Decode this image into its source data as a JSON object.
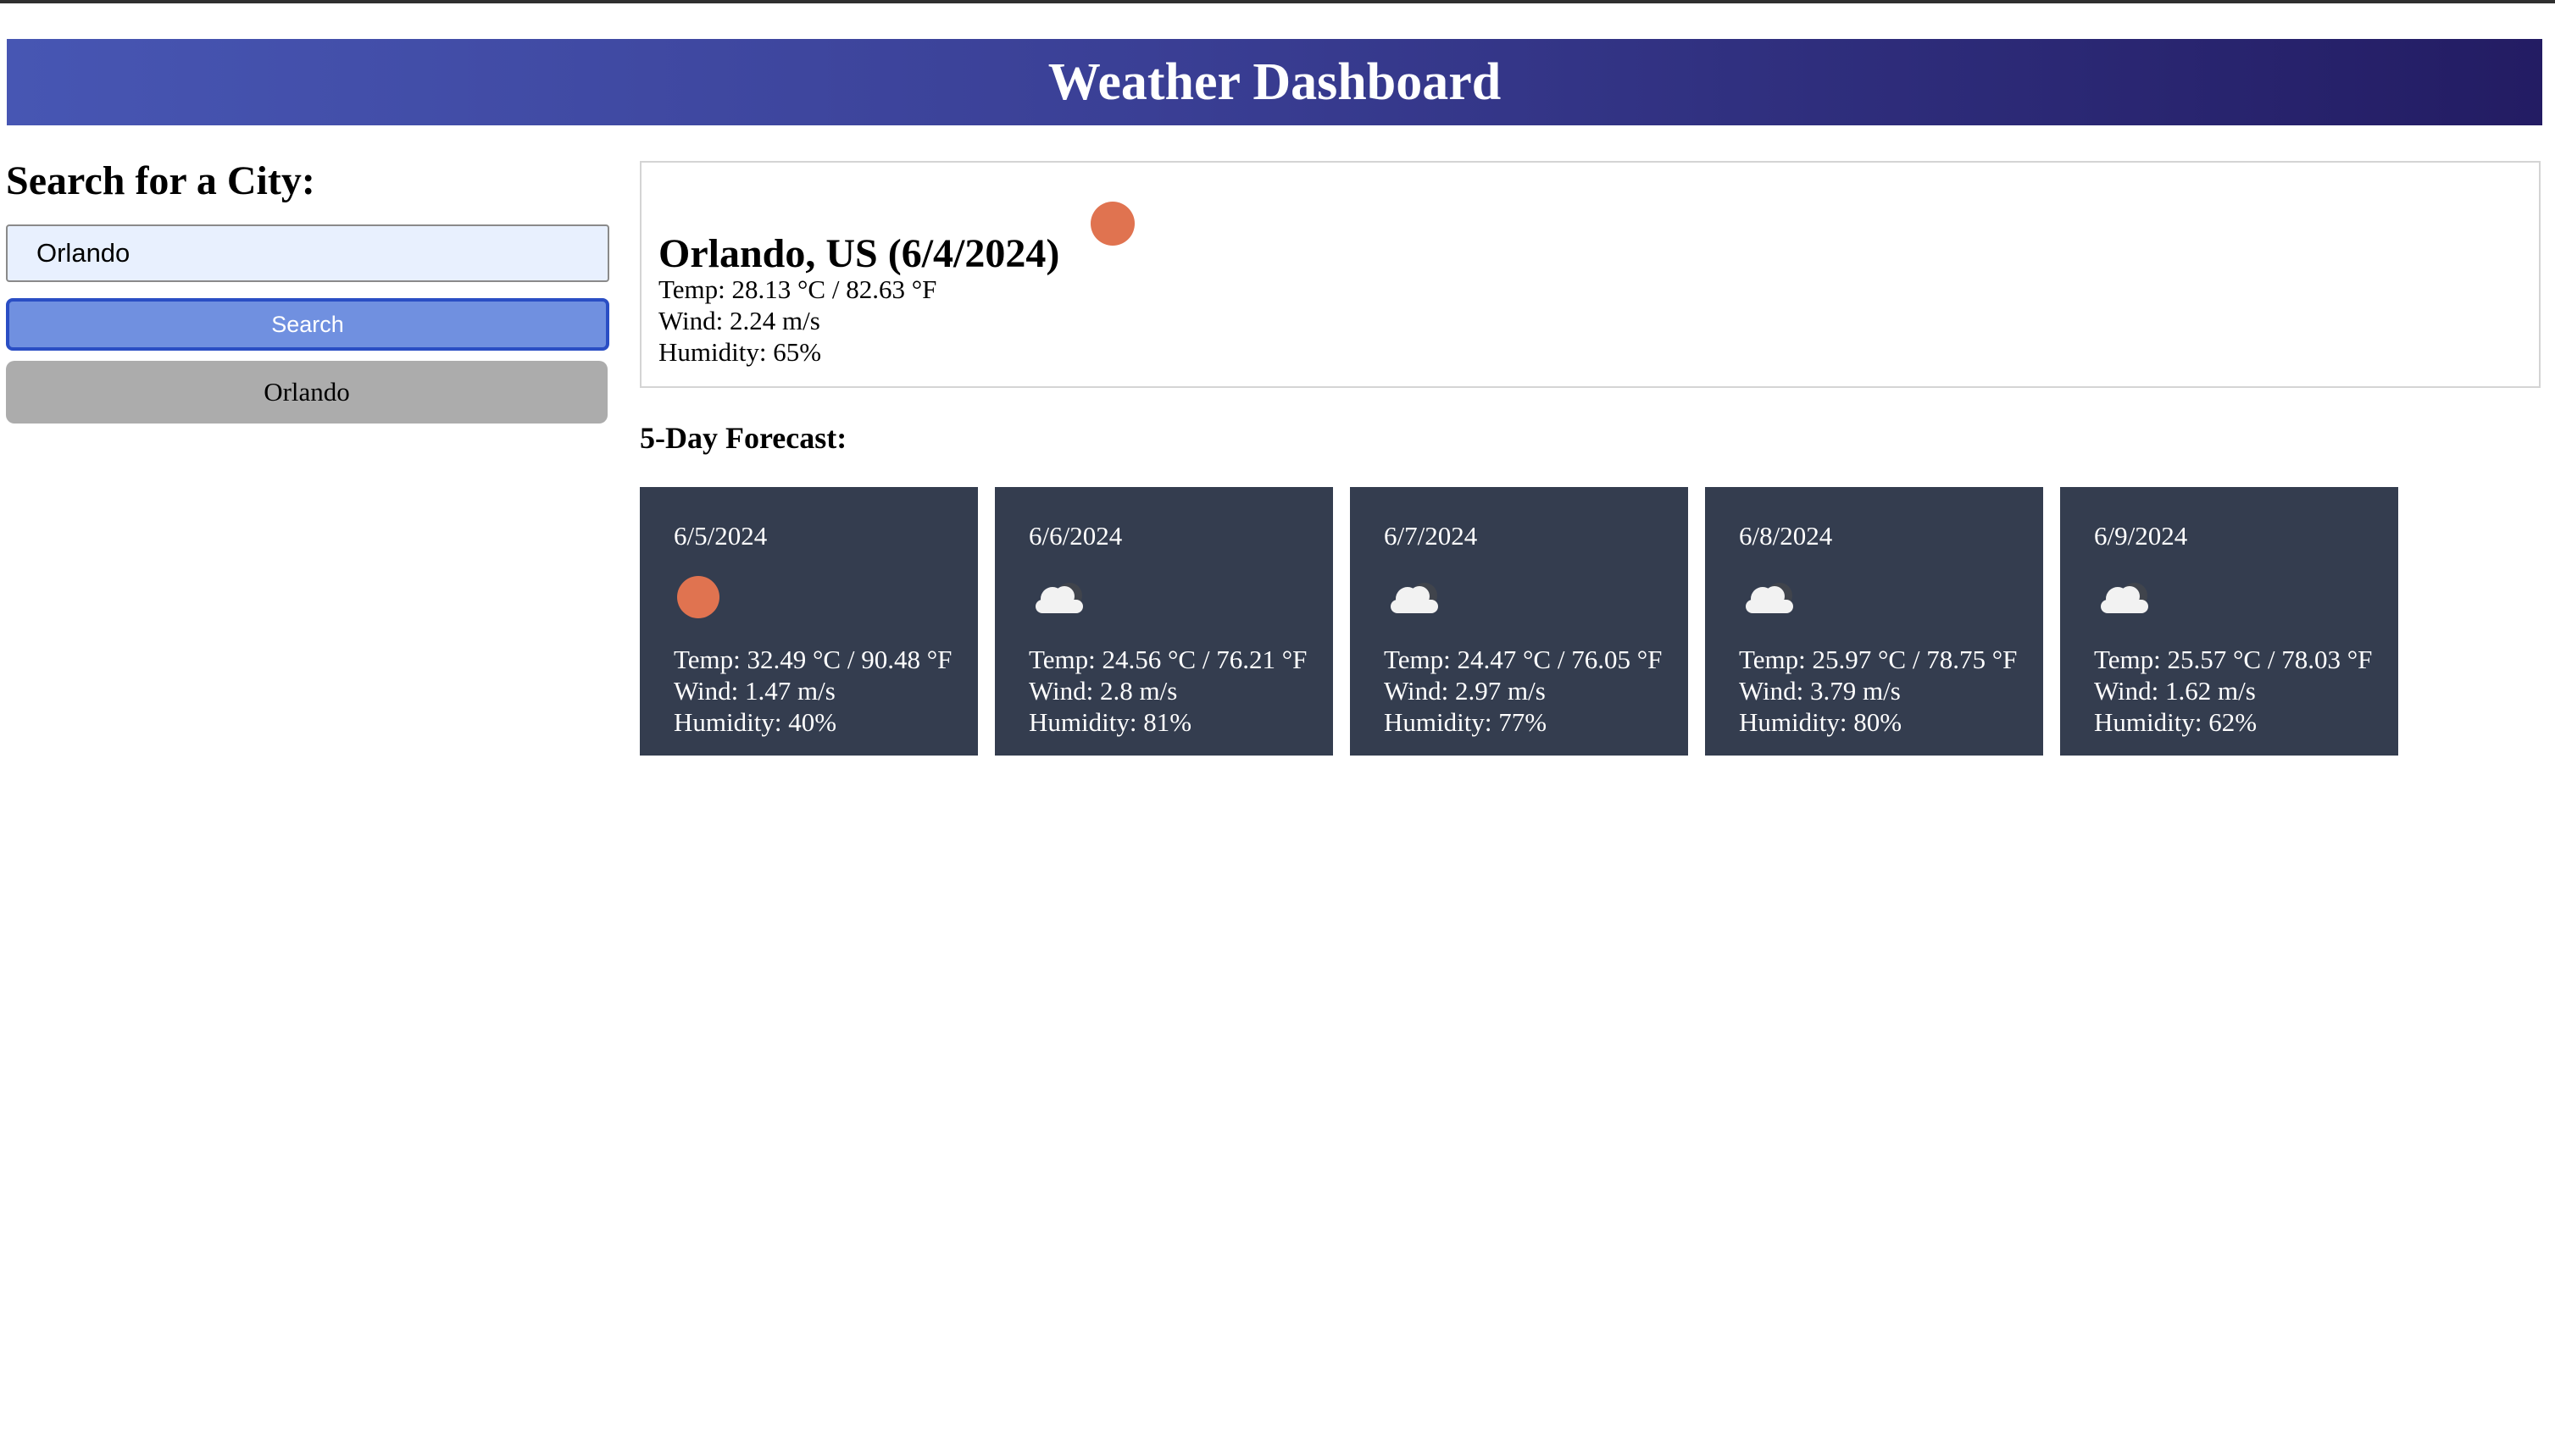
{
  "header": {
    "title": "Weather Dashboard"
  },
  "search": {
    "title": "Search for a City:",
    "input_value": "Orlando",
    "button_label": "Search",
    "history": [
      "Orlando"
    ]
  },
  "current": {
    "title": "Orlando, US (6/4/2024)",
    "icon": "sun-icon",
    "temp": "Temp: 28.13 °C / 82.63 °F",
    "wind": "Wind: 2.24 m/s",
    "humidity": "Humidity: 65%"
  },
  "forecast": {
    "title": "5-Day Forecast:",
    "days": [
      {
        "date": "6/5/2024",
        "icon": "sun-icon",
        "temp": "Temp: 32.49 °C / 90.48 °F",
        "wind": "Wind: 1.47 m/s",
        "humidity": "Humidity: 40%"
      },
      {
        "date": "6/6/2024",
        "icon": "cloud-icon",
        "temp": "Temp: 24.56 °C / 76.21 °F",
        "wind": "Wind: 2.8 m/s",
        "humidity": "Humidity: 81%"
      },
      {
        "date": "6/7/2024",
        "icon": "cloud-icon",
        "temp": "Temp: 24.47 °C / 76.05 °F",
        "wind": "Wind: 2.97 m/s",
        "humidity": "Humidity: 77%"
      },
      {
        "date": "6/8/2024",
        "icon": "cloud-icon",
        "temp": "Temp: 25.97 °C / 78.75 °F",
        "wind": "Wind: 3.79 m/s",
        "humidity": "Humidity: 80%"
      },
      {
        "date": "6/9/2024",
        "icon": "cloud-icon",
        "temp": "Temp: 25.57 °C / 78.03 °F",
        "wind": "Wind: 1.62 m/s",
        "humidity": "Humidity: 62%"
      }
    ]
  },
  "colors": {
    "header_gradient_start": "#4756b3",
    "header_gradient_end": "#231c63",
    "search_button": "#7090e0",
    "history_button": "#acacac",
    "forecast_card": "#343d4f",
    "sun": "#e07350"
  }
}
